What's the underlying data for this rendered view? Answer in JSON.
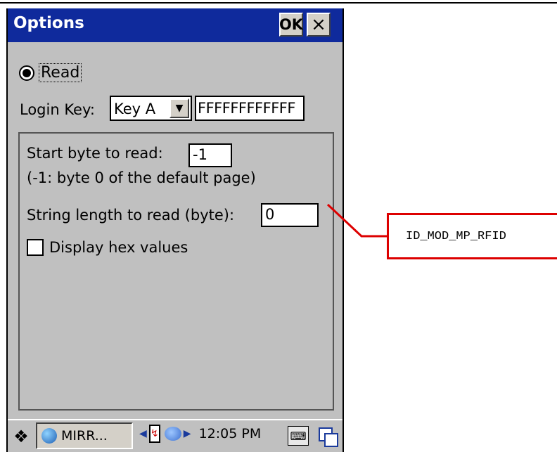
{
  "window": {
    "title": "Options",
    "ok_label": "OK",
    "close_label": "×"
  },
  "mode": {
    "read_label": "Read",
    "read_selected": true
  },
  "login": {
    "label": "Login Key:",
    "key_type": "Key A",
    "key_value": "FFFFFFFFFFFF"
  },
  "panel": {
    "start_byte_label": "Start byte to read:",
    "start_byte_value": "-1",
    "start_byte_hint": "(-1: byte 0 of the default page)",
    "length_label": "String length to read (byte):",
    "length_value": "0",
    "hex_label": "Display hex values",
    "hex_checked": false
  },
  "taskbar": {
    "app_label": "MIRR...",
    "clock": "12:05 PM"
  },
  "callout": {
    "id_label": "ID_MOD_MP_RFID",
    "color": "#dd0000"
  },
  "colors": {
    "titlebar": "#0f2a9c",
    "window_bg": "#c0c0c0"
  }
}
